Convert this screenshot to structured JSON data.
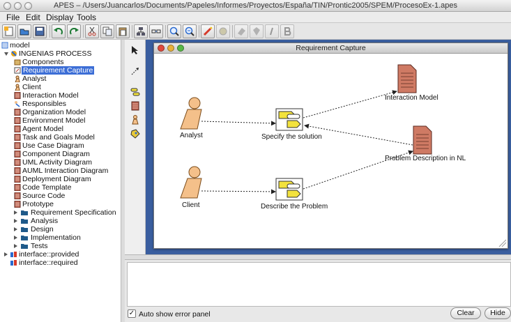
{
  "window": {
    "title": "APES – /Users/Juancarlos/Documents/Papeles/Informes/Proyectos/España/TIN/Prontic2005/SPEM/ProcesoEx-1.apes"
  },
  "menu": [
    "File",
    "Edit",
    "Display",
    "Tools"
  ],
  "toolbar": {
    "icons": [
      "new-file-icon",
      "open-folder-icon",
      "save-icon",
      "undo-icon",
      "redo-icon",
      "cut-icon",
      "copy-icon",
      "paste-icon",
      "network-icon",
      "link-icon",
      "zoom-in-icon",
      "zoom-out-icon",
      "wand-icon",
      "palette-icon",
      "diamond-icon",
      "gem-icon",
      "italic-icon",
      "bold-icon"
    ]
  },
  "tree": {
    "root": "model",
    "process": "INGENIAS PROCESS",
    "children": [
      "Components",
      "Requirement Capture",
      "Analyst",
      "Client",
      "Interaction Model",
      "Responsibles",
      "Organization Model",
      "Environment Model",
      "Agent Model",
      "Task and Goals Model",
      "Use Case Diagram",
      "Component Diagram",
      "UML Activity Diagram",
      "AUML Interaction Diagram",
      "Deployment Diagram",
      "Code Template",
      "Source Code",
      "Prototype"
    ],
    "folders": [
      "Requirement Specification",
      "Analysis",
      "Design",
      "Implementation",
      "Tests"
    ],
    "interfaces": [
      "interface::provided",
      "interface::required"
    ],
    "selected": "Requirement Capture"
  },
  "diagram": {
    "title": "Requirement Capture",
    "nodes": {
      "analyst": "Analyst",
      "client": "Client",
      "specify": "Specify the solution",
      "describe": "Describe the Problem",
      "interaction": "Interaction Model",
      "problem": "Problem Description in NL"
    }
  },
  "errors": {
    "auto_show_label": "Auto show error panel",
    "clear_label": "Clear",
    "hide_label": "Hide"
  }
}
